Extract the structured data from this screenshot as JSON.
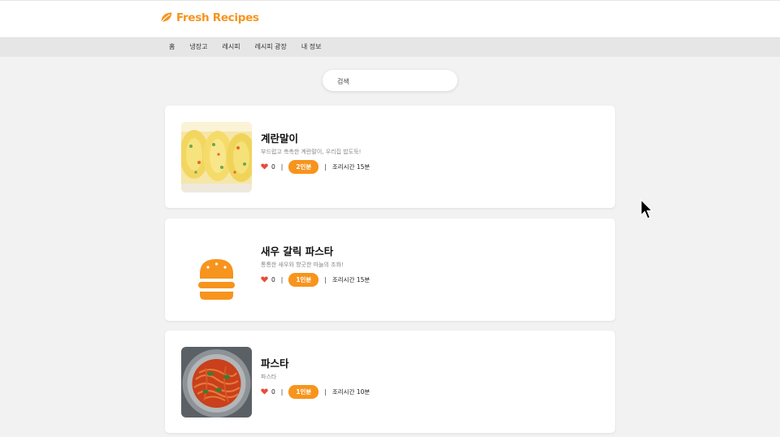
{
  "brand": {
    "name": "Fresh Recipes",
    "icon": "leaf-icon",
    "color": "#f7941d"
  },
  "nav": {
    "items": [
      {
        "label": "홈"
      },
      {
        "label": "냉장고"
      },
      {
        "label": "레시피"
      },
      {
        "label": "레시피 광장"
      },
      {
        "label": "내 정보"
      }
    ]
  },
  "search": {
    "placeholder": "검색",
    "value": ""
  },
  "recipes": [
    {
      "title": "계란말이",
      "description": "부드럽고 촉촉한 계란말이, 우리집 밥도둑!",
      "likes": "0",
      "servings": "2인분",
      "cook_time": "조리시간 15분",
      "image": "rolled-omelette-photo"
    },
    {
      "title": "새우 갈릭 파스타",
      "description": "통통한 새우와 향긋한 마늘의 조화!",
      "likes": "0",
      "servings": "1인분",
      "cook_time": "조리시간 15분",
      "image": "burger-placeholder-icon"
    },
    {
      "title": "파스타",
      "description": "파스타",
      "likes": "0",
      "servings": "1인분",
      "cook_time": "조리시간 10분",
      "image": "spaghetti-photo"
    }
  ],
  "colors": {
    "accent": "#f7941d",
    "heart": "#e74c3c",
    "background": "#f2f2f2"
  }
}
